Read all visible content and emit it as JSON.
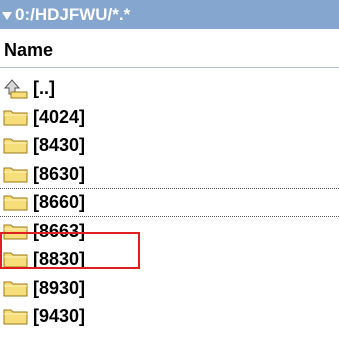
{
  "path_bar": {
    "path": "0:/HDJFWU/*.*"
  },
  "column_header": {
    "name_label": "Name"
  },
  "entries": [
    {
      "label": "[..]",
      "icon": "parent-directory-icon"
    },
    {
      "label": "[4024]",
      "icon": "folder-icon"
    },
    {
      "label": "[8430]",
      "icon": "folder-icon"
    },
    {
      "label": "[8630]",
      "icon": "folder-icon"
    },
    {
      "label": "[8660]",
      "icon": "folder-icon",
      "focused": true
    },
    {
      "label": "[8663]",
      "icon": "folder-icon",
      "highlighted": true
    },
    {
      "label": "[8830]",
      "icon": "folder-icon"
    },
    {
      "label": "[8930]",
      "icon": "folder-icon"
    },
    {
      "label": "[9430]",
      "icon": "folder-icon"
    }
  ],
  "colors": {
    "path_bar_bg": "#84a6cf",
    "folder_fill": "#f6de7a",
    "folder_outline": "#9c7a18",
    "highlight_border": "#e02020"
  }
}
